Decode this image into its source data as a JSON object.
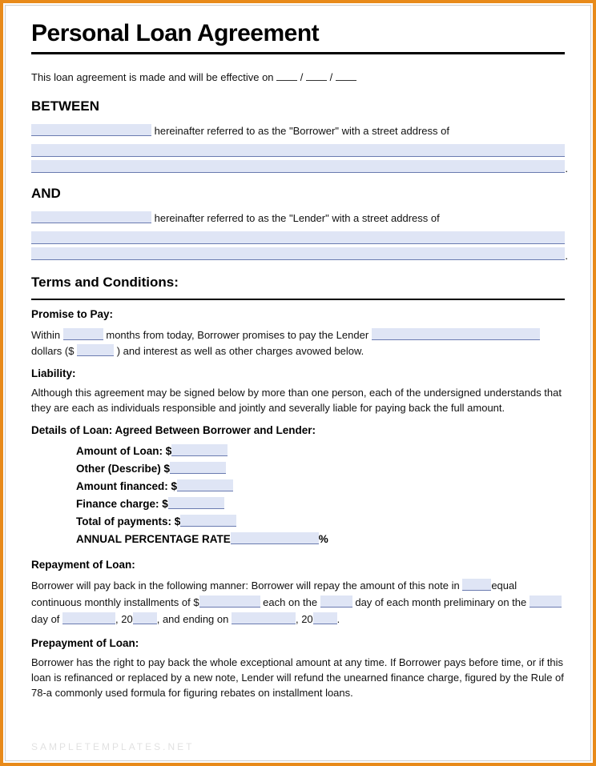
{
  "title": "Personal Loan Agreement",
  "intro": {
    "prefix": "This loan agreement is made and will be effective on ",
    "sep": "/"
  },
  "between": {
    "heading": "BETWEEN",
    "text": " hereinafter referred to as the \"Borrower\" with a street address of"
  },
  "and": {
    "heading": "AND",
    "text": " hereinafter referred to as the \"Lender\" with a street address of"
  },
  "terms_heading": "Terms and Conditions:",
  "promise": {
    "heading": "Promise to Pay:",
    "t1": "Within ",
    "t2": " months from today, Borrower promises to pay the Lender",
    "t3": "dollars ($",
    "t4": ") and interest as well as other charges avowed below."
  },
  "liability": {
    "heading": "Liability:",
    "text": "Although this agreement may be signed below by more than one person, each of the undersigned understands that they are each as individuals responsible and jointly and severally liable for paying back the full amount."
  },
  "details": {
    "heading": "Details of Loan: Agreed Between Borrower and Lender:",
    "rows": {
      "amount": "Amount of Loan: $",
      "other": "Other (Describe) $",
      "financed": "Amount financed: $",
      "finance_charge": "Finance charge: $",
      "total": "Total of payments: $",
      "apr": "ANNUAL PERCENTAGE RATE",
      "pct": "%"
    }
  },
  "repayment": {
    "heading": "Repayment of Loan:",
    "t1": "Borrower will pay back in the following manner: Borrower will repay the amount of this note in ",
    "t2": "equal continuous monthly installments of $",
    "t3": " each on the ",
    "t4": " day of each month preliminary on the ",
    "t5": "day of ",
    "t6": ", 20",
    "t7": ", and ending on ",
    "t8": ", 20",
    "t9": "."
  },
  "prepayment": {
    "heading": "Prepayment of Loan:",
    "text": "Borrower has the right to pay back the whole exceptional amount at any time. If Borrower pays before time, or if this loan is refinanced or replaced by a new note, Lender will refund the unearned finance charge, figured by the Rule of 78-a commonly used formula for figuring rebates on installment loans."
  },
  "watermark": "SAMPLETEMPLATES.NET"
}
